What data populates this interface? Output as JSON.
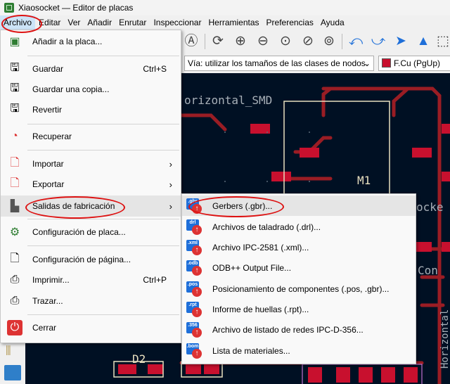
{
  "window": {
    "title": "Xiaosocket — Editor de placas"
  },
  "menubar": [
    "Archivo",
    "Editar",
    "Ver",
    "Añadir",
    "Enrutar",
    "Inspeccionar",
    "Herramientas",
    "Preferencias",
    "Ayuda"
  ],
  "optbar": {
    "via_dropdown": "Vía: utilizar los tamaños de las clases de nodos",
    "layer_dropdown": "F.Cu (PgUp)"
  },
  "pcb_labels": {
    "footprint_text": "orizontal_SMD",
    "module": "M1",
    "socket_text": "ocke",
    "con_text": "Con",
    "d2": "D2",
    "vertical_text": "Horizontal"
  },
  "file_menu": {
    "items": [
      {
        "label": "Añadir a la placa...",
        "icon": "add-board-icon"
      },
      {
        "label": "Guardar",
        "shortcut": "Ctrl+S",
        "icon": "save-icon"
      },
      {
        "label": "Guardar una copia...",
        "icon": "save-copy-icon"
      },
      {
        "label": "Revertir",
        "icon": "revert-icon"
      },
      {
        "label": "Recuperar",
        "icon": "recover-icon"
      },
      {
        "label": "Importar",
        "icon": "import-icon",
        "submenu": true
      },
      {
        "label": "Exportar",
        "icon": "export-icon",
        "submenu": true
      },
      {
        "label": "Salidas de fabricación",
        "icon": "fabrication-icon",
        "submenu": true
      },
      {
        "label": "Configuración de placa...",
        "icon": "board-setup-icon"
      },
      {
        "label": "Configuración de página...",
        "icon": "page-setup-icon"
      },
      {
        "label": "Imprimir...",
        "shortcut": "Ctrl+P",
        "icon": "print-icon"
      },
      {
        "label": "Trazar...",
        "icon": "plot-icon"
      },
      {
        "label": "Cerrar",
        "icon": "power-icon"
      }
    ]
  },
  "fab_submenu": {
    "items": [
      {
        "label": "Gerbers (.gbr)...",
        "tag": ".gbr"
      },
      {
        "label": "Archivos de taladrado (.drl)...",
        "tag": "drl"
      },
      {
        "label": "Archivo IPC-2581 (.xml)...",
        "tag": ".xml"
      },
      {
        "label": "ODB++ Output File...",
        "tag": ".odb"
      },
      {
        "label": "Posicionamiento de componentes (.pos, .gbr)...",
        "tag": ".pos"
      },
      {
        "label": "Informe de huellas (.rpt)...",
        "tag": ".rpt"
      },
      {
        "label": "Archivo de listado de redes IPC-D-356...",
        "tag": ".356"
      },
      {
        "label": "Lista de materiales...",
        "tag": ".bom"
      }
    ]
  },
  "colors": {
    "board_bg": "#001023",
    "copper_front": "#c8102e",
    "outline": "#e8e0c0",
    "menu_highlight": "#cce4f7",
    "annotation": "#dd1111"
  }
}
